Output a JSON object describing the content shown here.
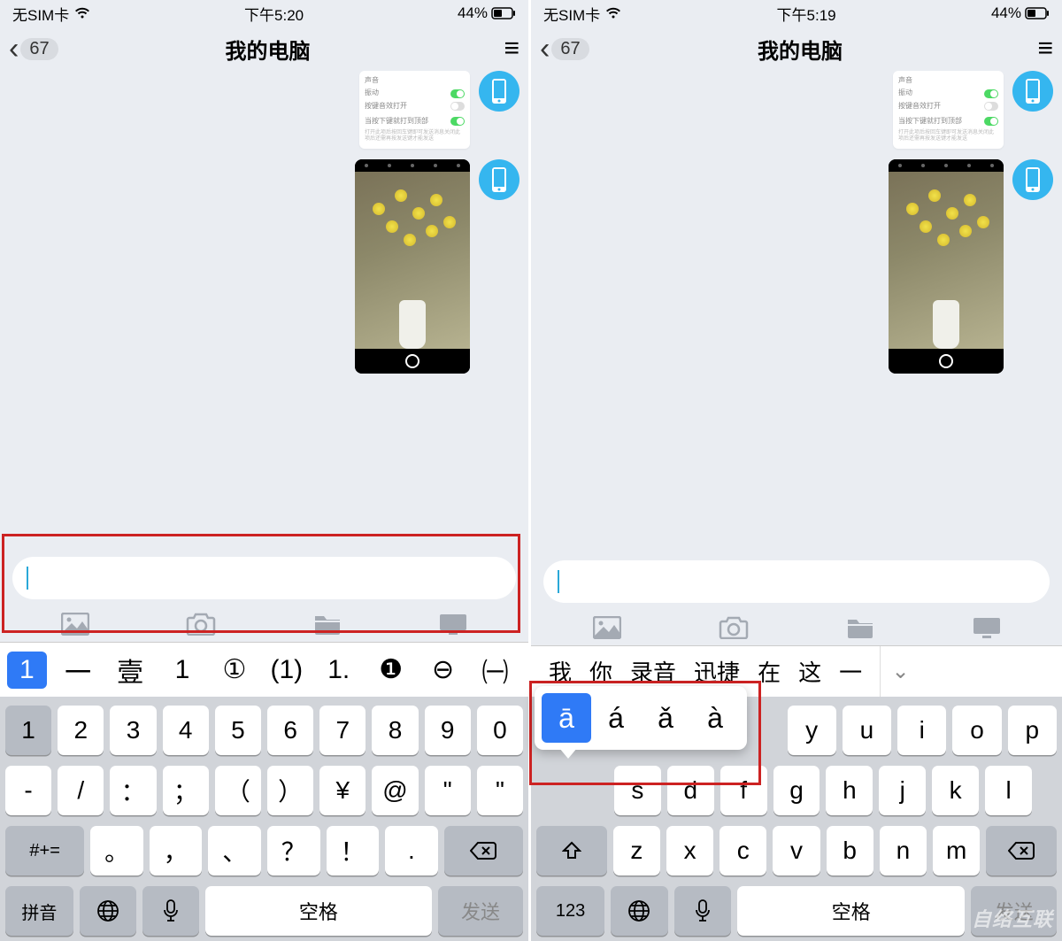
{
  "left": {
    "status": {
      "carrier": "无SIM卡",
      "time": "下午5:20",
      "battery_pct": "44%"
    },
    "nav": {
      "back_badge": "67",
      "title": "我的电脑"
    },
    "candidates": {
      "selected": "1",
      "options": [
        "一",
        "壹",
        "1",
        "①",
        "(1)",
        "1.",
        "❶",
        "⊖",
        "㈠"
      ]
    },
    "keyboard": {
      "row1": [
        "1",
        "2",
        "3",
        "4",
        "5",
        "6",
        "7",
        "8",
        "9",
        "0"
      ],
      "row2": [
        "-",
        "/",
        "：",
        "；",
        "（",
        "）",
        "¥",
        "@",
        "\"",
        "\""
      ],
      "row3_mode": "#+=",
      "row3": [
        "。",
        "，",
        "、",
        "？",
        "！",
        "."
      ],
      "bottom": {
        "pinyin": "拼音",
        "space": "空格",
        "send": "发送"
      }
    }
  },
  "right": {
    "status": {
      "carrier": "无SIM卡",
      "time": "下午5:19",
      "battery_pct": "44%"
    },
    "nav": {
      "back_badge": "67",
      "title": "我的电脑"
    },
    "candidates": {
      "words": [
        "我",
        "你",
        "录音",
        "迅捷",
        "在",
        "这",
        "一"
      ]
    },
    "popup": {
      "selected": "ā",
      "options": [
        "á",
        "ǎ",
        "à"
      ]
    },
    "keyboard": {
      "row1_visible": [
        "y",
        "u",
        "i",
        "o",
        "p"
      ],
      "row2_visible": [
        "s",
        "d",
        "f",
        "g",
        "h",
        "j",
        "k",
        "l"
      ],
      "row3_visible": [
        "z",
        "x",
        "c",
        "v",
        "b",
        "n",
        "m"
      ],
      "bottom": {
        "mode123": "123",
        "space": "空格",
        "send": "发送"
      }
    }
  },
  "watermark": "自络互联"
}
